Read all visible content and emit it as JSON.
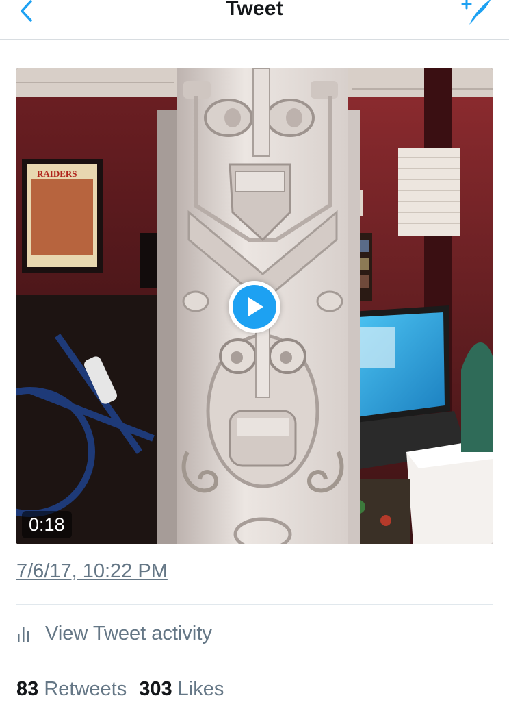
{
  "header": {
    "title": "Tweet",
    "back_icon": "chevron-left-icon",
    "compose_icon": "compose-tweet-icon",
    "accent_color": "#1da1f2"
  },
  "media": {
    "type": "video",
    "duration": "0:18",
    "play_icon": "play-icon",
    "poster_text": "RAIDERS"
  },
  "tweet": {
    "timestamp": "7/6/17, 10:22 PM"
  },
  "activity": {
    "icon": "bar-chart-icon",
    "label": "View Tweet activity"
  },
  "stats": {
    "retweets_count": "83",
    "retweets_label": "Retweets",
    "likes_count": "303",
    "likes_label": "Likes"
  }
}
